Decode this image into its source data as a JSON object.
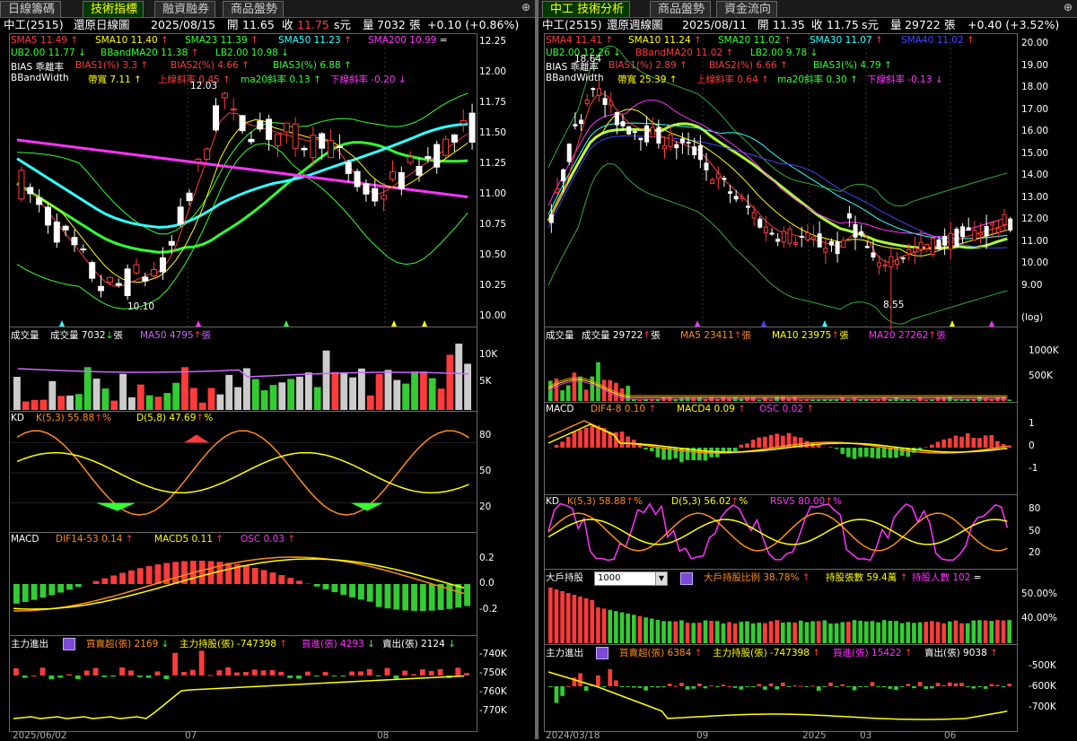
{
  "left": {
    "tabs": [
      "日線籌碼",
      "技術指標",
      "融資融券",
      "商品盤勢"
    ],
    "info": {
      "name": "中工(2515)",
      "mode": "還原日線圖",
      "date": "2025/08/15",
      "open_label": "開",
      "open": "11.65",
      "close_label": "收",
      "close": "11.75",
      "unit": "s元",
      "vol_label": "量",
      "vol": "7032",
      "vol_unit": "張",
      "chg": "+0.10 (+0.86%)"
    },
    "price_legend": [
      {
        "t": "SMA5 11.49",
        "c": "#ff3b3b",
        "a": "up"
      },
      {
        "t": "SMA10 11.40",
        "c": "#ffff00",
        "a": "up"
      },
      {
        "t": "SMA23 11.39",
        "c": "#33ff33",
        "a": "up"
      },
      {
        "t": "SMA50 11.23",
        "c": "#33ffff",
        "a": "up"
      },
      {
        "t": "SMA200 10.99",
        "c": "#ff33ff",
        "a": "eq"
      }
    ],
    "bb_legend": [
      {
        "t": "UB2.00 11.77",
        "c": "#33ff33",
        "a": "down"
      },
      {
        "t": "BBandMA20 11.38",
        "c": "#33ff33",
        "a": "up"
      },
      {
        "t": "LB2.00 10.98",
        "c": "#33ff33",
        "a": "down"
      }
    ],
    "bias": {
      "name": "BIAS 乖離率",
      "b1": "BIAS1(%) 3.3",
      "b2": "BIAS2(%) 4.66",
      "b3": "BIAS3(%) 6.88"
    },
    "bbw": {
      "name": "BBandWidth",
      "w": "帶寬 7.11",
      "u": "上線斜率 0.45",
      "m": "ma20斜率 0.13",
      "l": "下線斜率 -0.20"
    },
    "price_axis": [
      "12.25",
      "12.00",
      "11.75",
      "11.50",
      "11.25",
      "11.00",
      "10.75",
      "10.50",
      "10.25",
      "10.00"
    ],
    "low_mark": "10.10",
    "high_mark": "12.03",
    "vol_title": "成交量",
    "vol_val": "成交量 7032",
    "vol_unit": "張",
    "vol_ma": "MA50 4795",
    "vol_axis": [
      "10K",
      "5K"
    ],
    "kd_title": "KD",
    "kd_k": "K(5,3) 55.88",
    "kd_d": "D(5,8) 47.69",
    "kd_pct": "%",
    "kd_axis": [
      "80",
      "50",
      "20"
    ],
    "macd_title": "MACD",
    "macd_dif": "DIF14-53 0.14",
    "macd_m": "MACD5 0.11",
    "macd_osc": "OSC 0.03",
    "macd_axis": [
      "0.2",
      "0.0",
      "-0.2"
    ],
    "main_title": "主力進出",
    "main_buysell": "買賣超(張) 2169",
    "main_hold": "主力持股(張) -747398",
    "main_buy": "買進(張) 4293",
    "main_sell": "賣出(張) 2124",
    "main_axis": [
      "-740K",
      "-750K",
      "-760K",
      "-770K"
    ],
    "x_axis": [
      "2025/06/02",
      "07",
      "08"
    ]
  },
  "right": {
    "tabs": [
      "中工 技術分析",
      "商品盤勢",
      "資金流向"
    ],
    "info": {
      "name": "中工(2515)",
      "mode": "還原週線圖",
      "date": "2025/08/11",
      "open_label": "開",
      "open": "11.35",
      "close_label": "收",
      "close": "11.75",
      "unit": "s元",
      "vol_label": "量",
      "vol": "29722",
      "vol_unit": "張",
      "chg": "+0.40 (+3.52%)"
    },
    "price_legend": [
      {
        "t": "SMA4 11.41",
        "c": "#ff3b3b",
        "a": "up"
      },
      {
        "t": "SMA10 11.24",
        "c": "#ffff00",
        "a": "up"
      },
      {
        "t": "SMA20 11.02",
        "c": "#33ff33",
        "a": "up"
      },
      {
        "t": "SMA30 11.07",
        "c": "#33ffff",
        "a": "up"
      },
      {
        "t": "SMA40 11.02",
        "c": "#4444ff",
        "a": "up"
      }
    ],
    "bb_legend": [
      {
        "t": "UB2.00 12.26",
        "c": "#33ff33",
        "a": "down"
      },
      {
        "t": "BBandMA20 11.02",
        "c": "#ff3b3b",
        "a": "up"
      },
      {
        "t": "LB2.00 9.78",
        "c": "#33ff33",
        "a": "down"
      }
    ],
    "bias": {
      "name": "BIAS 乖離率",
      "b1": "BIAS1(%) 2.89",
      "b2": "BIAS2(%) 6.66",
      "b3": "BIAS3(%) 4.79"
    },
    "bbw": {
      "name": "BBandWidth",
      "w": "帶寬 25.39",
      "u": "上線斜率 0.64",
      "m": "ma20斜率 0.30",
      "l": "下線斜率 -0.13"
    },
    "price_axis": [
      "20.00",
      "19.00",
      "18.00",
      "17.00",
      "16.00",
      "15.00",
      "14.00",
      "13.00",
      "12.00",
      "11.00",
      "10.00",
      "9.00"
    ],
    "log_label": "(log)",
    "high_mark": "18.64",
    "low_mark": "8.55",
    "vol_title": "成交量",
    "vol_val": "成交量 29722",
    "vol_unit": "張",
    "vol_ma5": "MA5 23411",
    "vol_ma10": "MA10 23975",
    "vol_ma20": "MA20 27262",
    "vol_axis": [
      "1000K",
      "500K"
    ],
    "macd_title": "MACD",
    "macd_dif": "DIF4-8 0.10",
    "macd_m": "MACD4 0.09",
    "macd_osc": "OSC 0.02",
    "macd_axis": [
      "1",
      "0",
      "-1"
    ],
    "kd_title": "KD",
    "kd_k": "K(5,3) 58.88",
    "kd_d": "D(5,3) 56.02",
    "kd_rsv": "RSV5 80.00",
    "kd_pct": "%",
    "kd_axis": [
      "80",
      "50",
      "20"
    ],
    "big_title": "大戶持股",
    "big_select": "1000",
    "big_ratio": "大戶持股比例 38.78%",
    "big_count": "持股張數 59.4萬",
    "big_people": "持股人數 102",
    "big_axis": [
      "50.00%",
      "40.00%"
    ],
    "main_title": "主力進出",
    "main_buysell": "買賣超(張) 6384",
    "main_hold": "主力持股(張) -747398",
    "main_buy": "買進(張) 15422",
    "main_sell": "賣出(張) 9038",
    "main_axis": [
      "-500K",
      "-600K",
      "-700K"
    ],
    "x_axis": [
      "2024/03/18",
      "09",
      "2025",
      "03",
      "06"
    ]
  }
}
